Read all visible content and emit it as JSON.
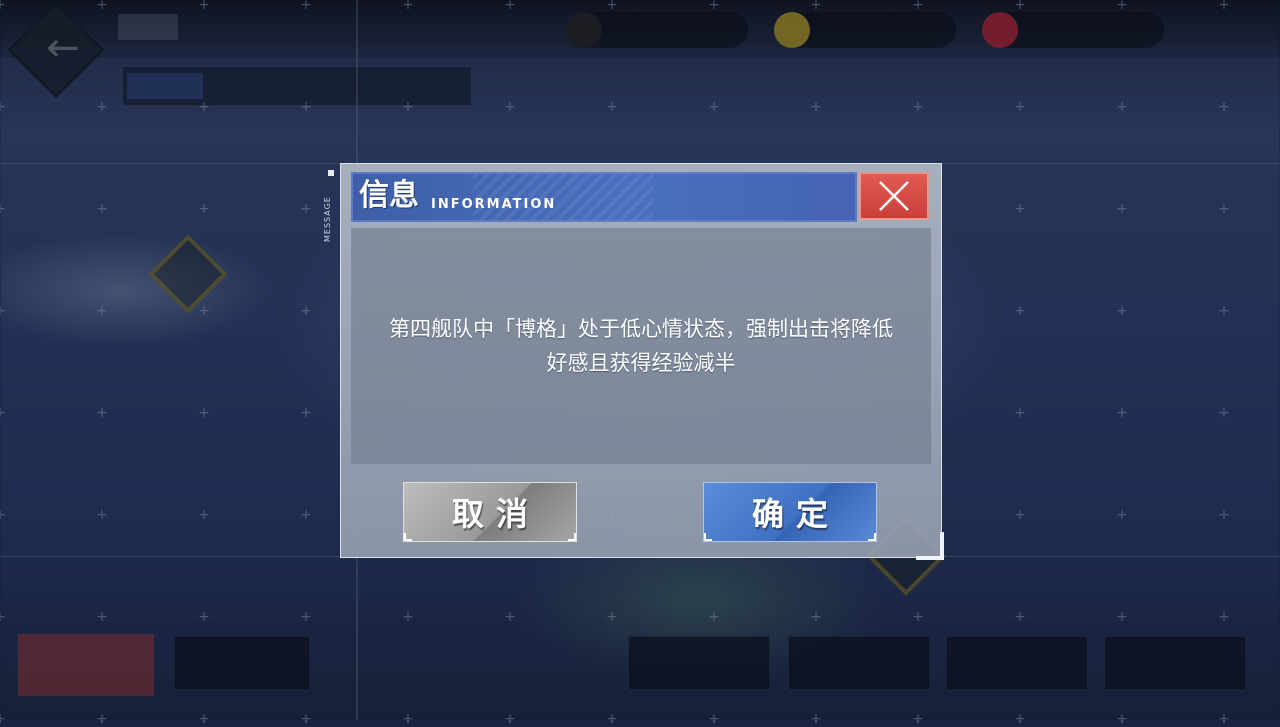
{
  "dialog": {
    "side_label": "MESSAGE",
    "title": "信息",
    "title_sub": "INFORMATION",
    "message_line1": "第四舰队中「博格」处于低心情状态，强制出击将降低",
    "message_line2": "好感且获得经验减半",
    "cancel_label": "取消",
    "confirm_label": "确定",
    "close_icon": "close-icon"
  },
  "colors": {
    "header_blue": "#4a6fbf",
    "close_red": "#d64a44",
    "confirm_blue": "#3f70c2",
    "cancel_gray": "#9a9a9a"
  }
}
